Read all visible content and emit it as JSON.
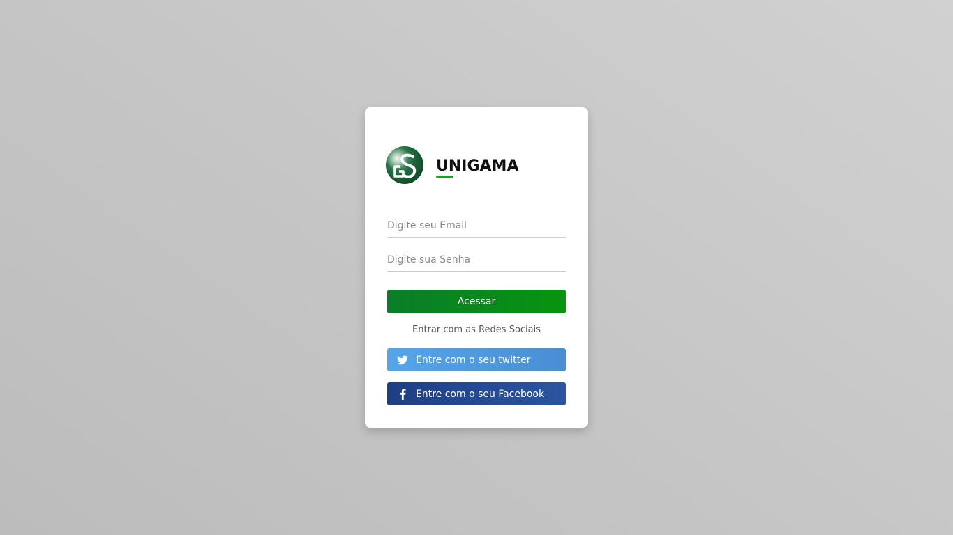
{
  "brand": {
    "name": "UNIGAMA",
    "logo_icon": "unigama-logo-icon",
    "accent_color": "#13a81c"
  },
  "login": {
    "email_placeholder": "Digite seu Email",
    "password_placeholder": "Digite sua Senha",
    "access_label": "Acessar",
    "social_caption": "Entrar com as Redes Sociais",
    "twitter_label": "Entre com o seu twitter",
    "facebook_label": "Entre com o seu Facebook"
  },
  "icons": {
    "twitter": "twitter-icon",
    "facebook": "facebook-icon"
  },
  "colors": {
    "access_button": "#079410",
    "twitter_button": "#55a5ea",
    "facebook_button": "#1f3e84"
  }
}
